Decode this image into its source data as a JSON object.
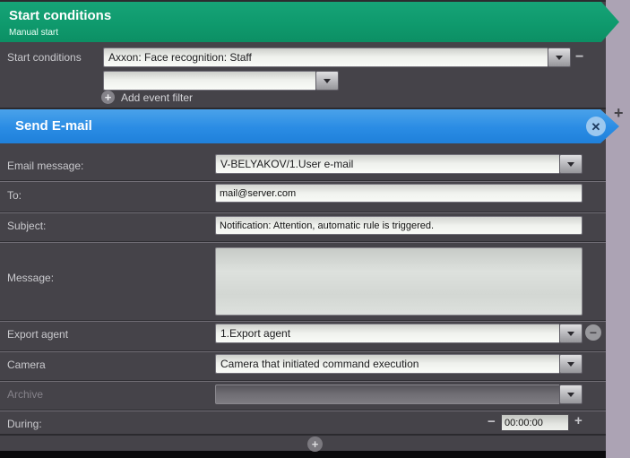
{
  "icons": {
    "minus": "−",
    "plus": "+",
    "close": "✕"
  },
  "start_section": {
    "title": "Start conditions",
    "subtitle": "Manual start",
    "row_label": "Start conditions",
    "event_filter_1": "Axxon: Face recognition: Staff",
    "event_filter_2": "",
    "add_event_filter_label": "Add event filter"
  },
  "email_section": {
    "title": "Send E-mail",
    "email_message_label": "Email message:",
    "email_message_value": "V-BELYAKOV/1.User e-mail",
    "to_label": "To:",
    "to_value": "mail@server.com",
    "subject_label": "Subject:",
    "subject_value": "Notification: Attention, automatic rule is triggered.",
    "message_label": "Message:",
    "message_value": "",
    "export_agent_label": "Export agent",
    "export_agent_value": "1.Export agent",
    "camera_label": "Camera",
    "camera_value": "Camera that initiated command execution",
    "archive_label": "Archive",
    "archive_value": "",
    "during_label": "During:",
    "during_value": "00:00:00"
  },
  "colors": {
    "start_header_green": "#0f9c6e",
    "send_email_header_blue": "#2b8de4",
    "panel_background": "#454349",
    "side_strip": "#aca3b4"
  }
}
